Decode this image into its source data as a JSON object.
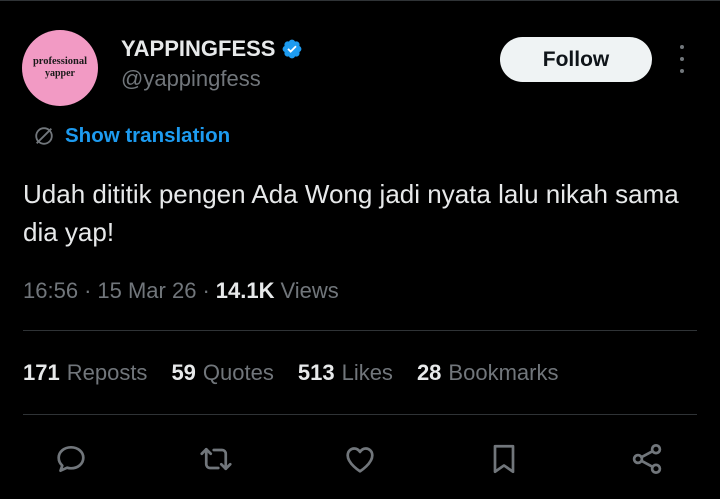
{
  "author": {
    "avatar_line1": "professional",
    "avatar_line2": "yapper",
    "name": "YAPPINGFESS",
    "handle": "@yappingfess"
  },
  "follow_label": "Follow",
  "show_translation": "Show translation",
  "tweet_text": "Udah dititik pengen Ada Wong jadi nyata lalu nikah sama dia yap!",
  "meta": {
    "time": "16:56",
    "date": "15 Mar 26",
    "views": "14.1K",
    "views_label": "Views"
  },
  "stats": {
    "reposts": "171",
    "reposts_label": "Reposts",
    "quotes": "59",
    "quotes_label": "Quotes",
    "likes": "513",
    "likes_label": "Likes",
    "bookmarks": "28",
    "bookmarks_label": "Bookmarks"
  },
  "colors": {
    "background": "#000000",
    "text": "#e7e9ea",
    "muted": "#71767b",
    "accent": "#1d9bf0",
    "avatar": "#f29ac4",
    "divider": "#2f3336"
  },
  "icons": [
    "verified-badge-icon",
    "more-options-icon",
    "translate-icon",
    "reply-icon",
    "repost-icon",
    "like-icon",
    "bookmark-icon",
    "share-icon"
  ]
}
